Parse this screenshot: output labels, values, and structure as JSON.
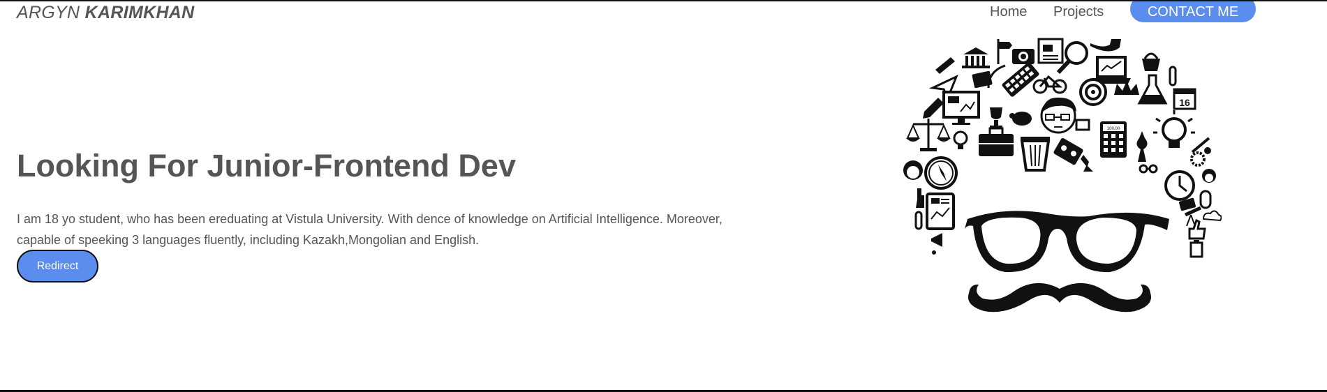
{
  "header": {
    "logo_first": "ARGYN",
    "logo_last": "KARIMKHAN",
    "nav": {
      "home": "Home",
      "projects": "Projects",
      "contact": "CONTACT ME"
    }
  },
  "hero": {
    "title": "Looking For Junior-Frontend Dev",
    "description": "I am 18 yo student, who has been ereduating at Vistula University. With dence of knowledge on Artificial Intelligence. Moreover, capable of speeking 3 languages fluently, including Kazakh,Mongolian and English.",
    "button": "Redirect"
  },
  "illustration": {
    "calendar_day": "16",
    "calculator_display": "100.00"
  },
  "colors": {
    "accent": "#5b8def",
    "text": "#555555",
    "ink": "#111111"
  }
}
